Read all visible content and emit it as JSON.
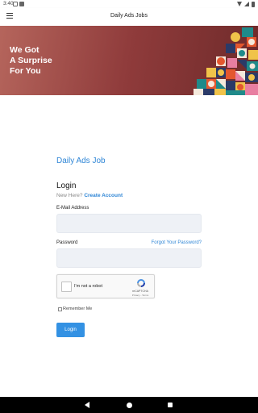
{
  "status_bar": {
    "time": "3:40"
  },
  "app_bar": {
    "title": "Daily Ads Jobs"
  },
  "banner": {
    "line1": "We Got",
    "line2": "A Surprise",
    "line3": "For You"
  },
  "login": {
    "brand": "Daily Ads Job",
    "heading": "Login",
    "new_here": "New Here?",
    "create_account": "Create Account",
    "email_label": "E-Mail Address",
    "email_value": "",
    "password_label": "Password",
    "password_value": "",
    "forgot_password": "Forgot Your Password?",
    "recaptcha_text": "I'm not a robot",
    "recaptcha_brand": "reCAPTCHA",
    "recaptcha_links": "Privacy - Terms",
    "remember_me": "Remember Me",
    "login_button": "Login"
  },
  "colors": {
    "accent": "#2f86d6",
    "button": "#3391e3",
    "banner_start": "#b5655c",
    "banner_end": "#6e2a2a"
  },
  "icons": {
    "menu": "menu-icon",
    "back": "back-icon",
    "home": "home-icon",
    "recent": "recent-apps-icon"
  }
}
